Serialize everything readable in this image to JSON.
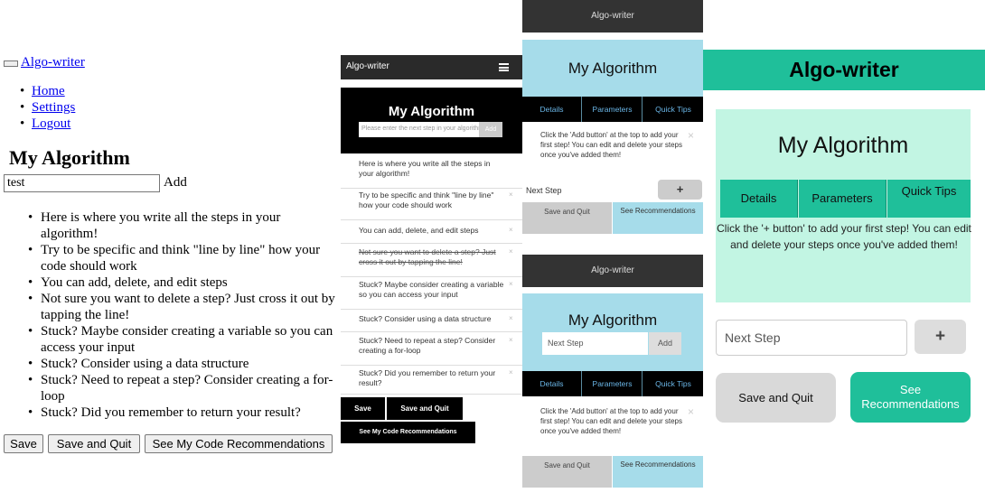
{
  "app_name": "Algo-writer",
  "page_title": "My Algorithm",
  "input": {
    "value": "test",
    "placeholder": "Please enter the next step in your algorithm",
    "next_step_placeholder": "Next Step",
    "add_label": "Add"
  },
  "nav": {
    "items": [
      "Home",
      "Settings",
      "Logout"
    ]
  },
  "steps": [
    "Here is where you write all the steps in your algorithm!",
    "Try to be specific and think \"line by line\" how your code should work",
    "You can add, delete, and edit steps",
    "Not sure you want to delete a step? Just cross it out by tapping the line!",
    "Stuck? Maybe consider creating a variable so you can access your input",
    "Stuck? Consider using a data structure",
    "Stuck? Need to repeat a step? Consider creating a for-loop",
    "Stuck? Did you remember to return your result?"
  ],
  "tabs": {
    "details": "Details",
    "parameters": "Parameters",
    "quick_tips": "Quick Tips"
  },
  "notes": {
    "teal": "Click the 'Add button' at the top to add your first step! You can edit and delete your steps once you've added them!",
    "green": "Click the '+ button' to add your first step! You can edit and delete your steps once you've added them!"
  },
  "buttons": {
    "save": "Save",
    "save_and_quit": "Save and Quit",
    "see_my_code_recommendations": "See My Code Recommendations",
    "see_recommendations": "See Recommendations",
    "plus": "+",
    "close": "×"
  },
  "colors": {
    "dark_bar": "#2a2a2a",
    "teal_hero": "#a6dcea",
    "green_brand": "#1fbf9a",
    "green_card": "#c2f5e3"
  }
}
